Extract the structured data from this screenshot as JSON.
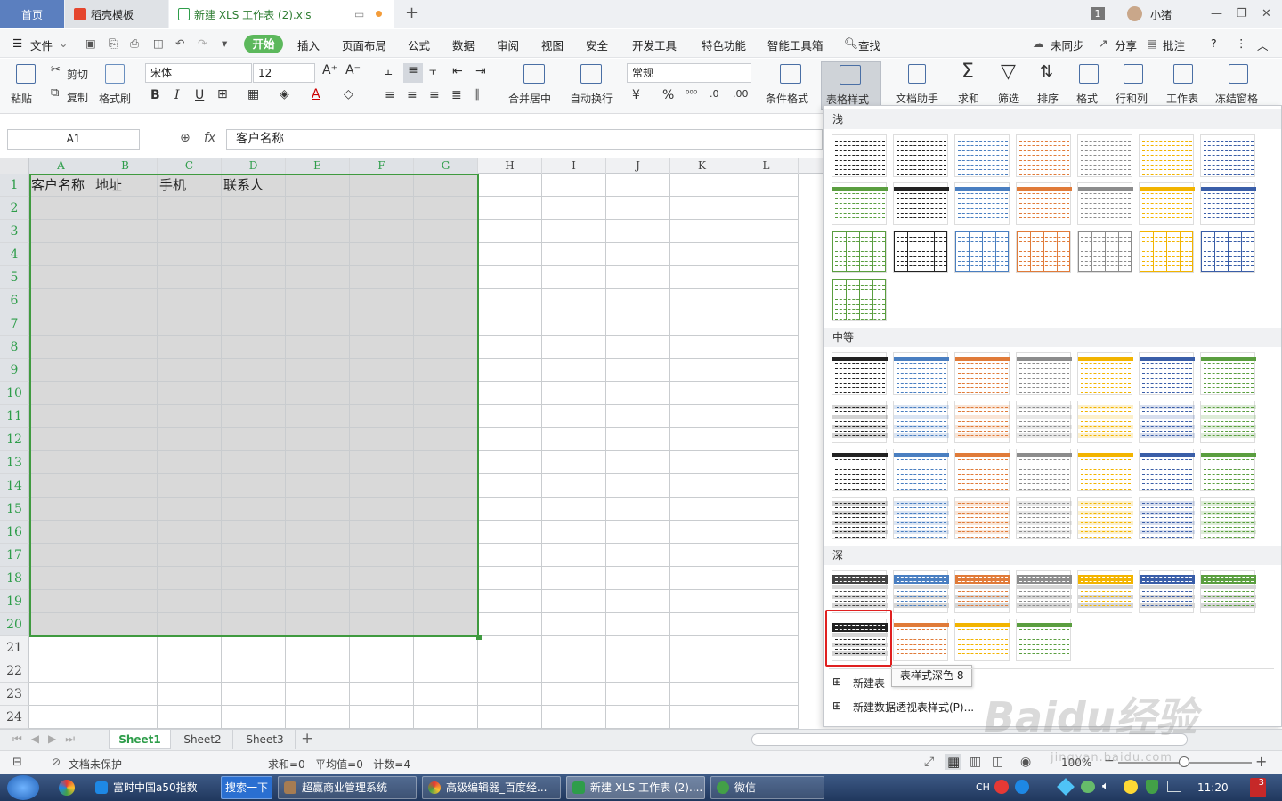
{
  "tabs": {
    "home": "首页",
    "template": "稻壳模板",
    "file": "新建 XLS 工作表 (2).xls",
    "user": "小猪",
    "page_count": "1"
  },
  "menu": {
    "file": "文件",
    "items": [
      "开始",
      "插入",
      "页面布局",
      "公式",
      "数据",
      "审阅",
      "视图",
      "安全",
      "开发工具",
      "特色功能",
      "智能工具箱",
      "查找"
    ],
    "sync": "未同步",
    "share": "分享",
    "comment": "批注",
    "help": "?"
  },
  "ribbon": {
    "paste": "粘贴",
    "cut": "剪切",
    "copy": "复制",
    "format_painter": "格式刷",
    "font": "宋体",
    "size": "12",
    "merge": "合并居中",
    "wrap": "自动换行",
    "number_format": "常规",
    "cond_format": "条件格式",
    "table_style": "表格样式",
    "doc_helper": "文档助手",
    "sum": "求和",
    "filter": "筛选",
    "sort": "排序",
    "format": "格式",
    "rowcol": "行和列",
    "worksheet": "工作表",
    "freeze": "冻结窗格",
    "bold": "B",
    "italic": "I",
    "underline": "U",
    "percent": "%"
  },
  "formula_bar": {
    "cell_ref": "A1",
    "fx": "fx",
    "content": "客户名称"
  },
  "sheet": {
    "columns": [
      "A",
      "B",
      "C",
      "D",
      "E",
      "F",
      "G",
      "H",
      "I",
      "J",
      "K",
      "L"
    ],
    "rows": [
      "1",
      "2",
      "3",
      "4",
      "5",
      "6",
      "7",
      "8",
      "9",
      "10",
      "11",
      "12",
      "13",
      "14",
      "15",
      "16",
      "17",
      "18",
      "19",
      "20",
      "21",
      "22",
      "23",
      "24"
    ],
    "row1": [
      "客户名称",
      "地址",
      "手机",
      "联系人",
      "",
      "",
      ""
    ]
  },
  "dropdown": {
    "light": "浅",
    "medium": "中等",
    "dark": "深",
    "tooltip": "表样式深色 8",
    "new_table_style": "新建表",
    "new_pivot_style": "新建数据透视表样式(P)...",
    "colors": [
      "#444444",
      "#4a7fc1",
      "#e07b39",
      "#8c8c8c",
      "#f2b400",
      "#3a5ea8",
      "#5a9e3f"
    ]
  },
  "sheet_tabs": [
    "Sheet1",
    "Sheet2",
    "Sheet3"
  ],
  "status": {
    "protect": "文档未保护",
    "stats": "求和=0   平均值=0   计数=4",
    "zoom": "100%"
  },
  "taskbar": {
    "items": [
      "富时中国a50指数",
      "搜索一下",
      "超赢商业管理系统",
      "高级编辑器_百度经...",
      "新建 XLS 工作表 (2)....",
      "微信"
    ],
    "lang": "CH",
    "time": "11:20",
    "badge": "3"
  },
  "watermark": {
    "brand": "Baidu经验",
    "url": "jingyan.baidu.com"
  }
}
